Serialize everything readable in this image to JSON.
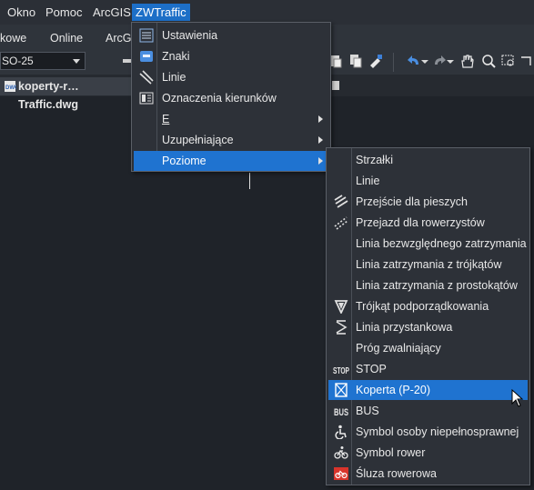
{
  "menubar": {
    "items": [
      "Okno",
      "Pomoc",
      "ArcGIS",
      "ZWTraffic"
    ]
  },
  "ribbon_tabs": [
    "kowe",
    "Online",
    "ArcG"
  ],
  "toolbar": {
    "layer_combo_value": "SO-25"
  },
  "document_tab": {
    "label": "koperty-r…Traffic.dwg"
  },
  "main_menu": {
    "items": [
      {
        "label": "Ustawienia",
        "icon": "settings-list-icon"
      },
      {
        "label": "Znaki",
        "icon": "sign-icon"
      },
      {
        "label": "Linie",
        "icon": "lines-icon"
      },
      {
        "label": "Oznaczenia kierunków",
        "icon": "direction-marking-icon"
      },
      {
        "label": "E",
        "icon": "",
        "submenu": true
      },
      {
        "label": "Uzupełniające",
        "icon": "",
        "submenu": true
      },
      {
        "label": "Poziome",
        "icon": "",
        "submenu": true,
        "selected": true
      }
    ]
  },
  "submenu": {
    "items": [
      {
        "label": "Strzałki",
        "icon": ""
      },
      {
        "label": "Linie",
        "icon": ""
      },
      {
        "label": "Przejście dla pieszych",
        "icon": "pedestrian-crossing-icon"
      },
      {
        "label": "Przejazd dla rowerzystów",
        "icon": "bicycle-crossing-icon"
      },
      {
        "label": "Linia bezwzględnego zatrzymania",
        "icon": ""
      },
      {
        "label": "Linia zatrzymania z trójkątów",
        "icon": ""
      },
      {
        "label": "Linia zatrzymania z prostokątów",
        "icon": ""
      },
      {
        "label": "Trójkąt podporządkowania",
        "icon": "yield-triangle-icon"
      },
      {
        "label": "Linia przystankowa",
        "icon": "bus-stop-line-icon"
      },
      {
        "label": "Próg zwalniający",
        "icon": ""
      },
      {
        "label": "STOP",
        "icon": "stop-text-icon"
      },
      {
        "label": "Koperta (P-20)",
        "icon": "koperta-icon",
        "selected": true
      },
      {
        "label": "BUS",
        "icon": "bus-text-icon"
      },
      {
        "label": "Symbol osoby niepełnosprawnej",
        "icon": "wheelchair-icon"
      },
      {
        "label": "Symbol rower",
        "icon": "bicycle-icon"
      },
      {
        "label": "Śluza rowerowa",
        "icon": "bike-box-icon"
      }
    ]
  },
  "colors": {
    "accent": "#1f73d0",
    "menu_bg": "#2d3138",
    "canvas_bg": "#1f2329"
  }
}
